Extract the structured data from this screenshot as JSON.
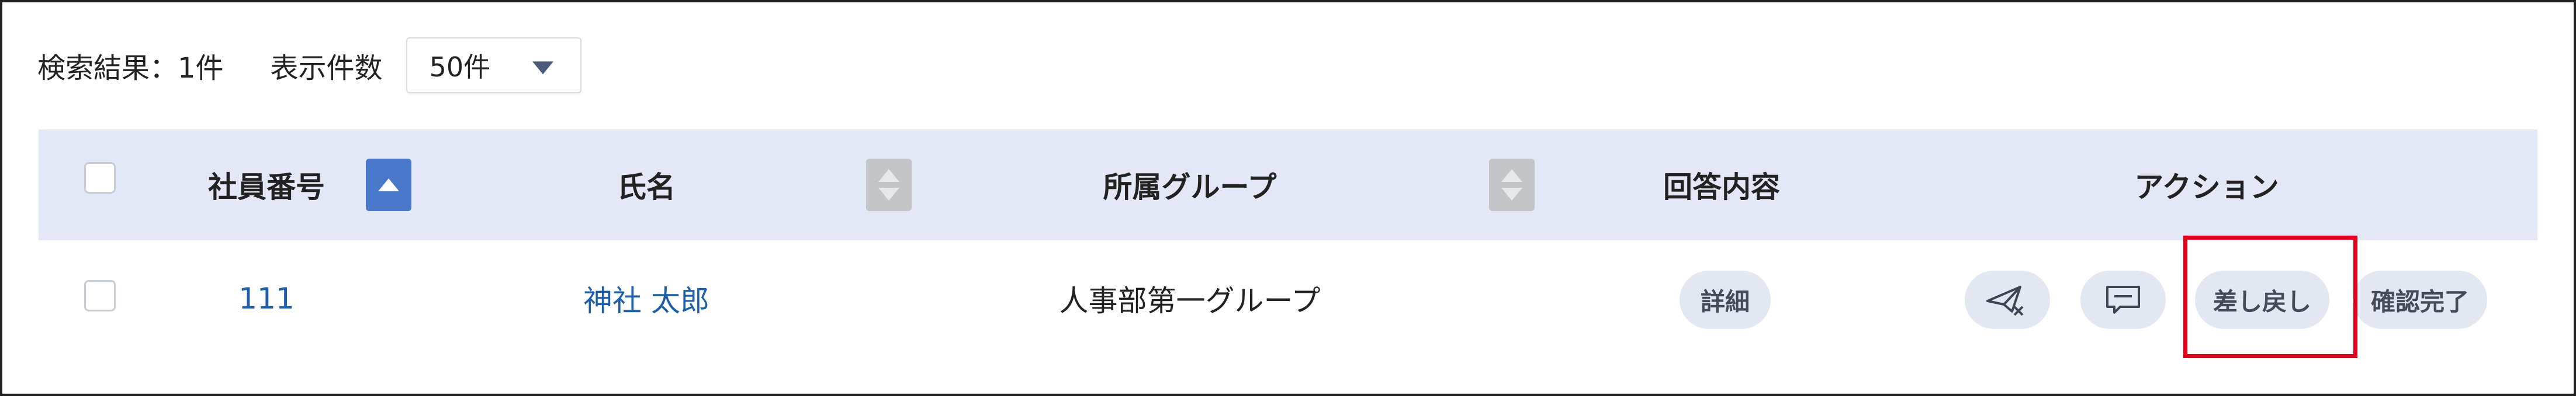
{
  "summary": {
    "result_text": "検索結果：1件",
    "perpage_label": "表示件数",
    "perpage_value": "50件"
  },
  "table": {
    "headers": {
      "employee_no": "社員番号",
      "name": "氏名",
      "group": "所属グループ",
      "answer": "回答内容",
      "action": "アクション"
    },
    "rows": [
      {
        "employee_no": "111",
        "name": "神社 太郎",
        "group": "人事部第一グループ",
        "answer_button": "詳細",
        "actions": {
          "send_cancel_icon": "paper-plane-x-icon",
          "comment_icon": "comment-icon",
          "return_label": "差し戻し",
          "complete_label": "確認完了"
        }
      }
    ]
  },
  "colors": {
    "header_bg": "#e3e7f6",
    "sort_active": "#4a78c8",
    "sort_inactive": "#c3c5c9",
    "link": "#1f5fa8",
    "pill_bg": "#e3e7f2",
    "highlight": "#e0001b"
  }
}
